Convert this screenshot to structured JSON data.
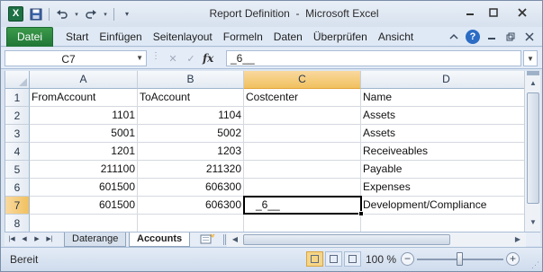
{
  "window": {
    "title": "Report Definition  -  Microsoft Excel",
    "app_icon": "X",
    "minimize_icon": "minimize-icon",
    "maximize_icon": "maximize-icon",
    "close_icon": "close-icon"
  },
  "quick_access": [
    {
      "name": "save-icon"
    },
    {
      "name": "undo-icon"
    },
    {
      "name": "redo-icon"
    },
    {
      "name": "customize-qat-icon"
    }
  ],
  "ribbon": {
    "file_tab": "Datei",
    "tabs": [
      "Start",
      "Einfügen",
      "Seitenlayout",
      "Formeln",
      "Daten",
      "Überprüfen",
      "Ansicht"
    ],
    "active_color": "#217a3b"
  },
  "formula_bar": {
    "name_box": "C7",
    "formula": "_6__",
    "fx_label": "fx"
  },
  "grid": {
    "columns": [
      "A",
      "B",
      "C",
      "D"
    ],
    "selected_column": "C",
    "rows": [
      "1",
      "2",
      "3",
      "4",
      "5",
      "6",
      "7",
      "8"
    ],
    "selected_row": "7",
    "cells": [
      [
        "FromAccount",
        "ToAccount",
        "Costcenter",
        "Name"
      ],
      [
        "1101",
        "1104",
        "",
        "Assets"
      ],
      [
        "5001",
        "5002",
        "",
        "Assets"
      ],
      [
        "1201",
        "1203",
        "",
        "Receiveables"
      ],
      [
        "211100",
        "211320",
        "",
        "Payable"
      ],
      [
        "601500",
        "606300",
        "",
        "Expenses"
      ],
      [
        "601500",
        "606300",
        "_6__",
        "Development/Compliance"
      ],
      [
        "",
        "",
        "",
        ""
      ]
    ],
    "active_cell": "C7"
  },
  "sheets": {
    "tabs": [
      "Daterange",
      "Accounts"
    ],
    "active": "Accounts"
  },
  "status": {
    "mode": "Bereit",
    "zoom": "100 %",
    "zoom_level_percent": 100,
    "active_view": "normal"
  }
}
